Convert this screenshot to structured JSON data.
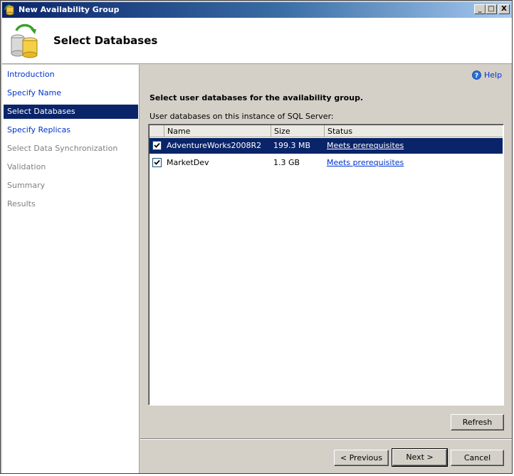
{
  "window": {
    "title": "New Availability Group",
    "controls": {
      "minimize": "_",
      "maximize": "□",
      "close": "X"
    }
  },
  "header": {
    "title": "Select Databases",
    "icon": "database-sync-icon"
  },
  "sidebar": {
    "items": [
      {
        "label": "Introduction",
        "state": "link"
      },
      {
        "label": "Specify Name",
        "state": "link"
      },
      {
        "label": "Select Databases",
        "state": "active"
      },
      {
        "label": "Specify Replicas",
        "state": "link"
      },
      {
        "label": "Select Data Synchronization",
        "state": "disabled"
      },
      {
        "label": "Validation",
        "state": "disabled"
      },
      {
        "label": "Summary",
        "state": "disabled"
      },
      {
        "label": "Results",
        "state": "disabled"
      }
    ]
  },
  "main": {
    "help_label": "Help",
    "section_title": "Select user databases for the availability group.",
    "grid_label": "User databases on this instance of SQL Server:",
    "columns": [
      "Name",
      "Size",
      "Status"
    ],
    "rows": [
      {
        "checked": true,
        "name": "AdventureWorks2008R2",
        "size": "199.3 MB",
        "status": "Meets prerequisites",
        "selected": true
      },
      {
        "checked": true,
        "name": "MarketDev",
        "size": "1.3 GB",
        "status": "Meets prerequisites",
        "selected": false
      }
    ]
  },
  "buttons": {
    "refresh": "Refresh",
    "previous": "< Previous",
    "next": "Next >",
    "cancel": "Cancel"
  },
  "colors": {
    "title_bar": "#0a246a",
    "selection": "#0a246a",
    "link": "#0033cc",
    "dialog_bg": "#d4d0c8"
  }
}
